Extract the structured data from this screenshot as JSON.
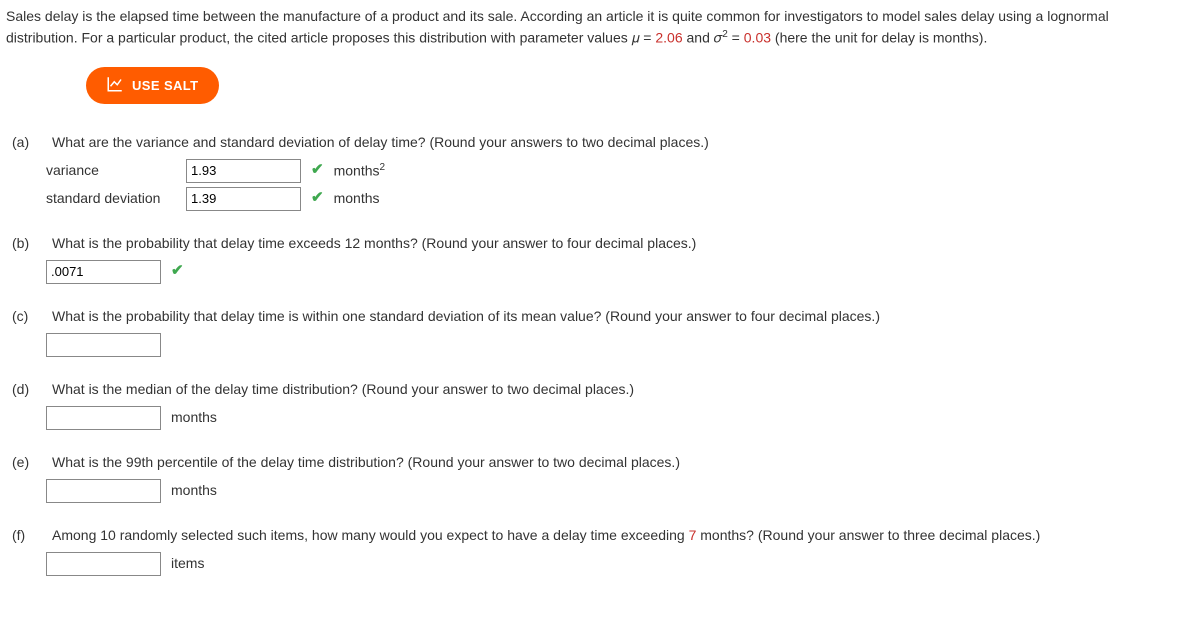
{
  "intro": {
    "text_before_mu": "Sales delay is the elapsed time between the manufacture of a product and its sale. According an article it is quite common for investigators to model sales delay using a lognormal distribution. For a particular product, the cited article proposes this distribution with parameter values 𝜇 = ",
    "mu_value": "2.06",
    "text_mid": " and 𝜎",
    "text_eq": " = ",
    "sigma2_value": "0.03",
    "text_after": " (here the unit for delay is months)."
  },
  "salt_label": "USE SALT",
  "parts": {
    "a": {
      "label": "(a)",
      "question": "What are the variance and standard deviation of delay time? (Round your answers to two decimal places.)",
      "rows": [
        {
          "label": "variance",
          "value": "1.93",
          "unit_pre": "months",
          "unit_sup": "2",
          "correct": true
        },
        {
          "label": "standard deviation",
          "value": "1.39",
          "unit_pre": "months",
          "unit_sup": "",
          "correct": true
        }
      ]
    },
    "b": {
      "label": "(b)",
      "question": "What is the probability that delay time exceeds 12 months? (Round your answer to four decimal places.)",
      "value": ".0071",
      "correct": true
    },
    "c": {
      "label": "(c)",
      "question": "What is the probability that delay time is within one standard deviation of its mean value? (Round your answer to four decimal places.)",
      "value": ""
    },
    "d": {
      "label": "(d)",
      "question": "What is the median of the delay time distribution? (Round your answer to two decimal places.)",
      "value": "",
      "unit": "months"
    },
    "e": {
      "label": "(e)",
      "question": "What is the 99th percentile of the delay time distribution? (Round your answer to two decimal places.)",
      "value": "",
      "unit": "months"
    },
    "f": {
      "label": "(f)",
      "question_pre": "Among 10 randomly selected such items, how many would you expect to have a delay time exceeding ",
      "highlight": "7",
      "question_post": " months? (Round your answer to three decimal places.)",
      "value": "",
      "unit": "items"
    }
  }
}
